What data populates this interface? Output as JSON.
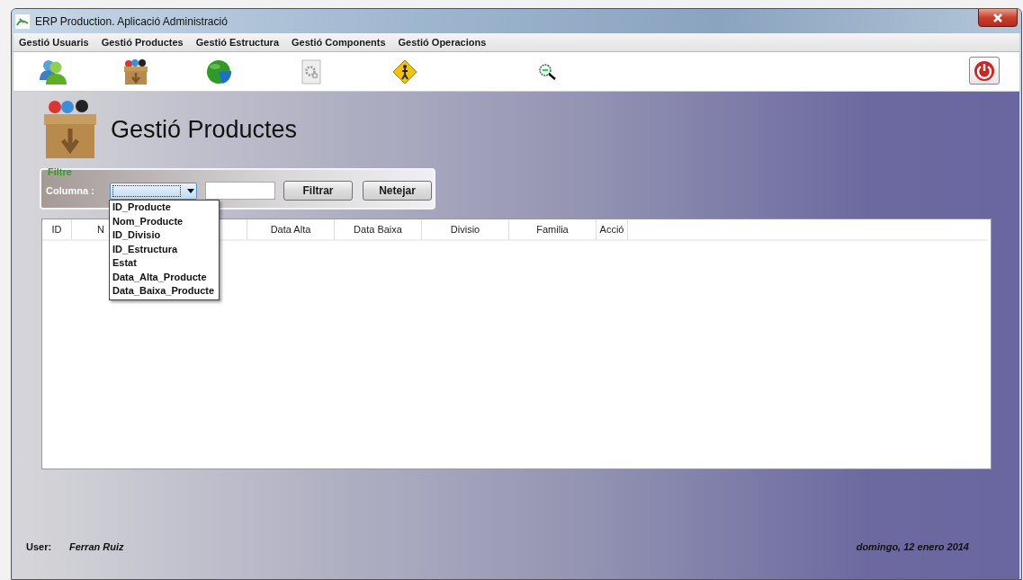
{
  "window": {
    "title": "ERP Production. Aplicació Administració"
  },
  "menu": [
    {
      "label": "Gestió Usuaris"
    },
    {
      "label": "Gestió Productes"
    },
    {
      "label": "Gestió Estructura"
    },
    {
      "label": "Gestió Components"
    },
    {
      "label": "Gestió Operacions"
    }
  ],
  "page": {
    "title": "Gestió Productes"
  },
  "filter": {
    "legend": "Filtre",
    "label": "Columna :",
    "column_dropdown": {
      "expanded": true,
      "options": [
        "ID_Producte",
        "Nom_Producte",
        "ID_Divisio",
        "ID_Estructura",
        "Estat",
        "Data_Alta_Producte",
        "Data_Baixa_Producte"
      ]
    },
    "buttons": [
      "Filtrar",
      "Netejar"
    ]
  },
  "table": {
    "columns": [
      "ID",
      "N",
      "Data Alta",
      "Data Baixa",
      "Divisio",
      "Familia",
      "Acció"
    ]
  },
  "status_bar": {
    "user_label": "User:",
    "user": "Ferran Ruiz",
    "date": "domingo, 12 enero 2014"
  }
}
